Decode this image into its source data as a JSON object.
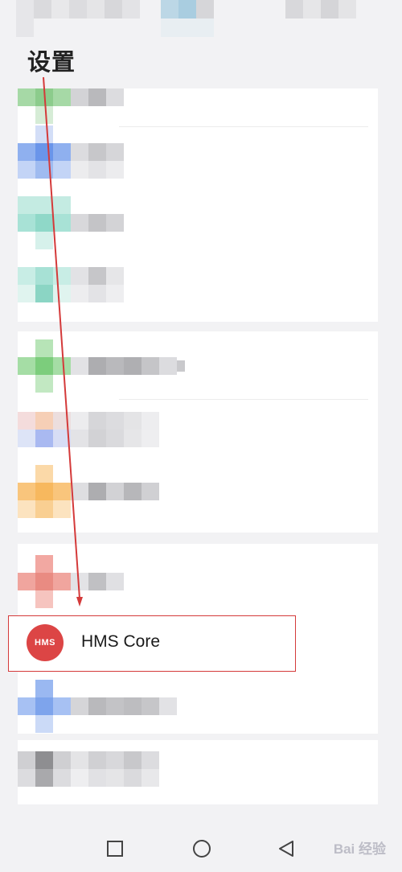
{
  "annotation": {
    "title": "设置"
  },
  "highlighted_item": {
    "icon": "hms-logo-icon",
    "icon_text": "HMS",
    "label": "HMS Core"
  },
  "navigation": {
    "recent": "square-icon",
    "home": "circle-icon",
    "back": "triangle-back-icon"
  },
  "watermark": {
    "text": "Bai 经验"
  },
  "colors": {
    "highlight_border": "#d43a3a",
    "arrow": "#d43a3a",
    "hms_icon_bg": "#dc4545"
  }
}
